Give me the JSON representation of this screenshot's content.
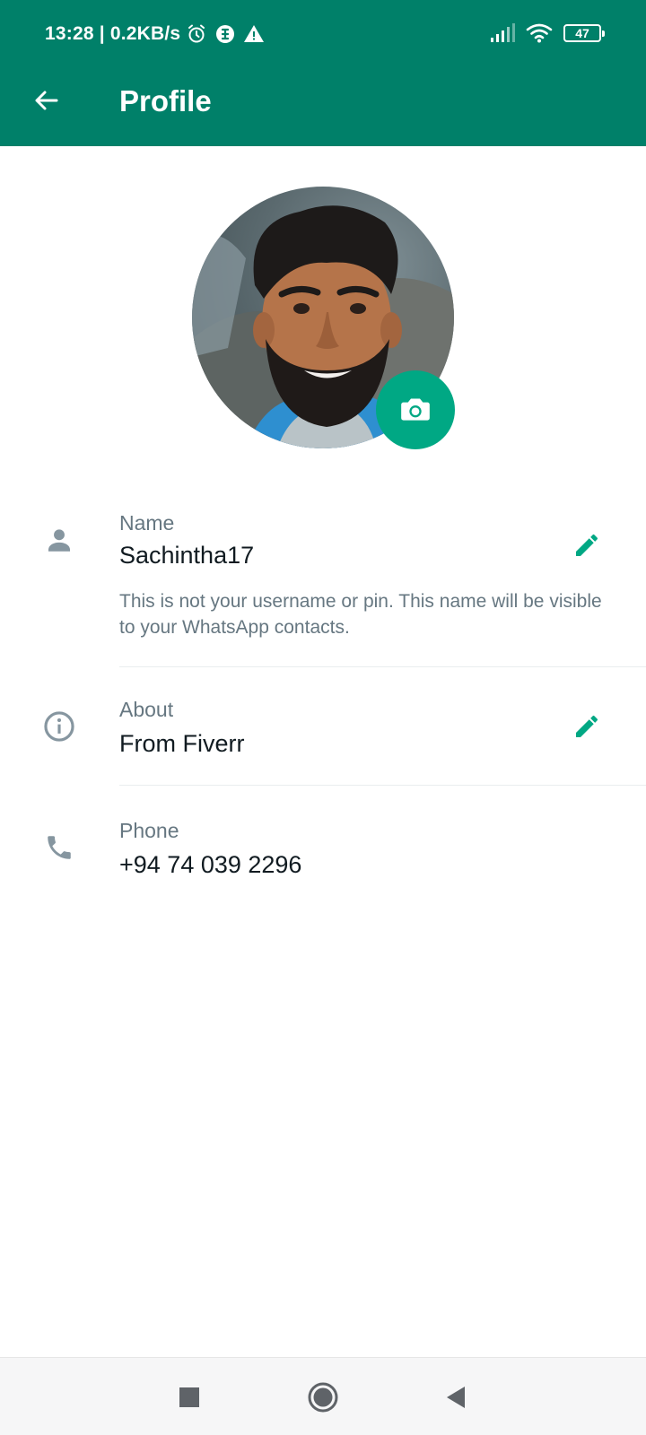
{
  "status_bar": {
    "time": "13:28",
    "net_speed": "| 0.2KB/s",
    "battery_level": "47",
    "icons": [
      "alarm-icon",
      "vpn-icon",
      "warning-icon",
      "signal-icon",
      "wifi-icon",
      "battery-icon"
    ]
  },
  "toolbar": {
    "title": "Profile",
    "back_icon": "arrow-left-icon"
  },
  "avatar": {
    "camera_icon": "camera-icon"
  },
  "profile": {
    "name": {
      "label": "Name",
      "value": "Sachintha17",
      "hint": "This is not your username or pin. This name will be visible to your WhatsApp contacts.",
      "icon": "person-icon",
      "edit_icon": "pencil-icon"
    },
    "about": {
      "label": "About",
      "value": "From Fiverr",
      "icon": "info-icon",
      "edit_icon": "pencil-icon"
    },
    "phone": {
      "label": "Phone",
      "value": "+94 74 039 2296",
      "icon": "phone-icon"
    }
  },
  "nav": {
    "icons": [
      "recents-icon",
      "home-icon",
      "back-icon"
    ]
  },
  "colors": {
    "header": "#008069",
    "accent": "#00a884",
    "secondary_text": "#667781",
    "primary_text": "#111b21",
    "row_icon": "#8696a0"
  }
}
